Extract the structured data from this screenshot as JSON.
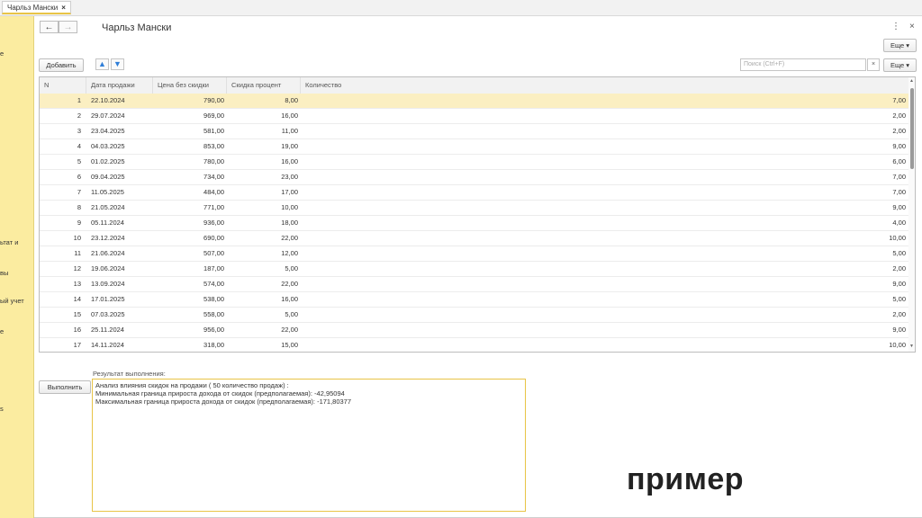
{
  "tab": {
    "title": "Чарльз Мански",
    "close": "×"
  },
  "sidebar": {
    "items": [
      "е",
      "ьтат и",
      "вы",
      "ый учет",
      "е",
      "s"
    ]
  },
  "header": {
    "title": "Чарльз Мански",
    "back_icon": "←",
    "forward_icon": "→",
    "more_icon": "⋮",
    "close_icon": "×"
  },
  "toolbar": {
    "add_label": "Добавить",
    "more_label_top": "Еще ▾",
    "more_label": "Еще ▾",
    "up_icon": "▲",
    "down_icon": "▼",
    "search_placeholder": "Поиск (Ctrl+F)",
    "search_clear": "×"
  },
  "table": {
    "headers": [
      "N",
      "Дата продажи",
      "Цена без скидки",
      "Скидка процент",
      "Количество"
    ],
    "selected_row": 0,
    "rows": [
      [
        "1",
        "22.10.2024",
        "790,00",
        "8,00",
        "7,00"
      ],
      [
        "2",
        "29.07.2024",
        "969,00",
        "16,00",
        "2,00"
      ],
      [
        "3",
        "23.04.2025",
        "581,00",
        "11,00",
        "2,00"
      ],
      [
        "4",
        "04.03.2025",
        "853,00",
        "19,00",
        "9,00"
      ],
      [
        "5",
        "01.02.2025",
        "780,00",
        "16,00",
        "6,00"
      ],
      [
        "6",
        "09.04.2025",
        "734,00",
        "23,00",
        "7,00"
      ],
      [
        "7",
        "11.05.2025",
        "484,00",
        "17,00",
        "7,00"
      ],
      [
        "8",
        "21.05.2024",
        "771,00",
        "10,00",
        "9,00"
      ],
      [
        "9",
        "05.11.2024",
        "936,00",
        "18,00",
        "4,00"
      ],
      [
        "10",
        "23.12.2024",
        "690,00",
        "22,00",
        "10,00"
      ],
      [
        "11",
        "21.06.2024",
        "507,00",
        "12,00",
        "5,00"
      ],
      [
        "12",
        "19.06.2024",
        "187,00",
        "5,00",
        "2,00"
      ],
      [
        "13",
        "13.09.2024",
        "574,00",
        "22,00",
        "9,00"
      ],
      [
        "14",
        "17.01.2025",
        "538,00",
        "16,00",
        "5,00"
      ],
      [
        "15",
        "07.03.2025",
        "558,00",
        "5,00",
        "2,00"
      ],
      [
        "16",
        "25.11.2024",
        "956,00",
        "22,00",
        "9,00"
      ],
      [
        "17",
        "14.11.2024",
        "318,00",
        "15,00",
        "10,00"
      ]
    ]
  },
  "result": {
    "run_label": "Выполнить",
    "label": "Результат выполнения:",
    "lines": [
      "Анализ влияния скидок на продажи ( 50 количество продаж) :",
      "Минимальная граница прироста дохода от скидок (предполагаемая): -42,95094",
      "Максимальная граница прироста дохода от скидок (предполагаемая): -171,80377"
    ]
  },
  "overlay_text": "пример",
  "colors": {
    "sidebar": "#fbeca0",
    "selected_row": "#fbefc2",
    "accent": "#e8c446",
    "arrow": "#2f7ed8"
  }
}
